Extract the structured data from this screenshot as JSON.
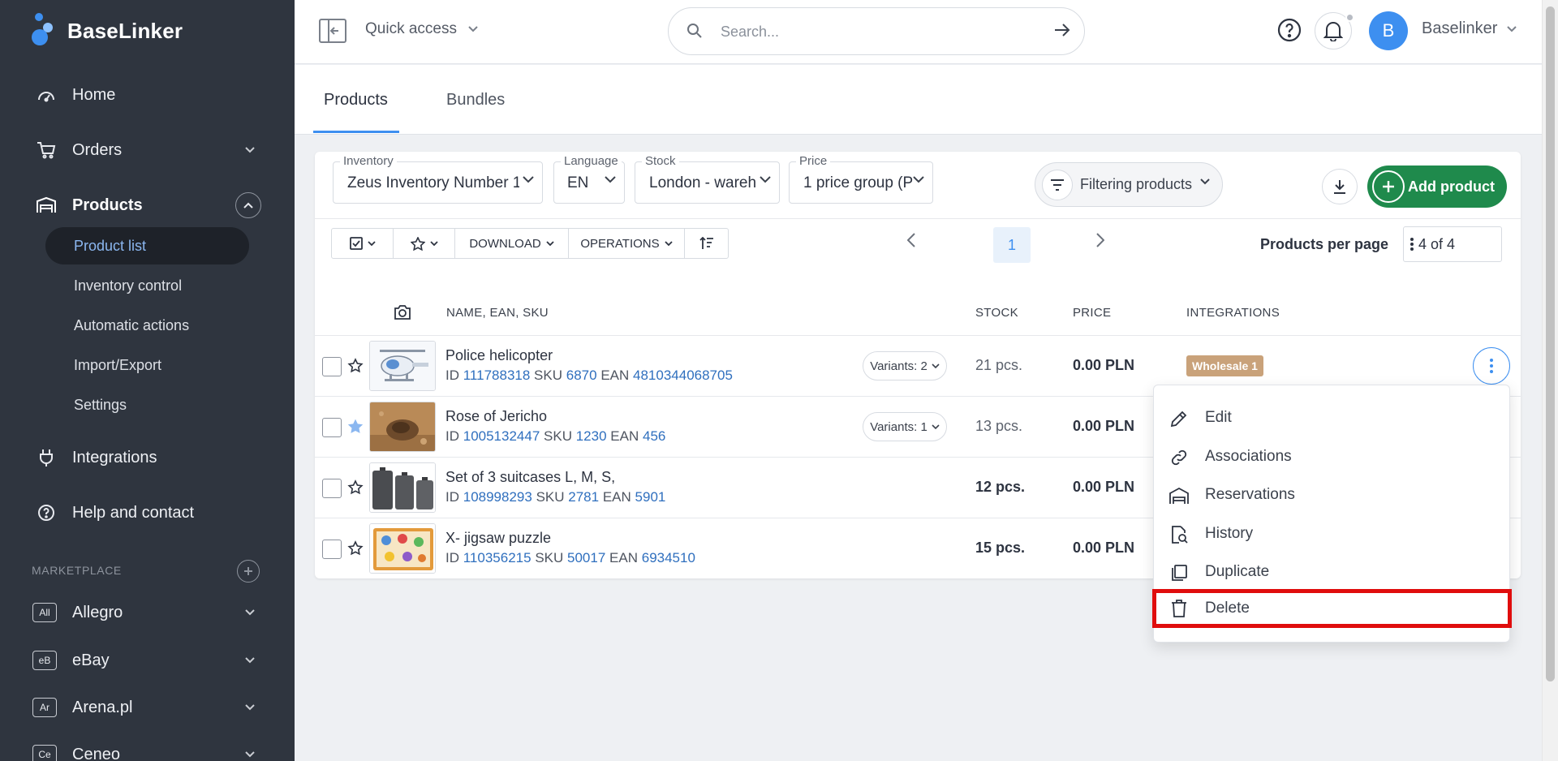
{
  "app": {
    "name": "BaseLinker"
  },
  "sidebar": {
    "nav": [
      {
        "label": "Home",
        "icon": "dashboard-icon"
      },
      {
        "label": "Orders",
        "icon": "cart-icon"
      },
      {
        "label": "Products",
        "icon": "warehouse-icon"
      },
      {
        "label": "Integrations",
        "icon": "plug-icon"
      },
      {
        "label": "Help and contact",
        "icon": "help-circle-icon"
      }
    ],
    "products_sub": [
      {
        "label": "Product list",
        "active": true
      },
      {
        "label": "Inventory control"
      },
      {
        "label": "Automatic actions"
      },
      {
        "label": "Import/Export"
      },
      {
        "label": "Settings"
      }
    ],
    "marketplace_label": "MARKETPLACE",
    "marketplaces": [
      {
        "badge": "All",
        "label": "Allegro"
      },
      {
        "badge": "eB",
        "label": "eBay"
      },
      {
        "badge": "Ar",
        "label": "Arena.pl"
      },
      {
        "badge": "Ce",
        "label": "Ceneo"
      }
    ]
  },
  "topbar": {
    "quick_access": "Quick access",
    "search_placeholder": "Search...",
    "user_initial": "B",
    "user_name": "Baselinker"
  },
  "tabs": [
    {
      "label": "Products",
      "active": true
    },
    {
      "label": "Bundles",
      "active": false
    }
  ],
  "filters": {
    "inventory": {
      "label": "Inventory",
      "value": "Zeus Inventory Number 1"
    },
    "language": {
      "label": "Language",
      "value": "EN"
    },
    "stock": {
      "label": "Stock",
      "value": "London - wareh"
    },
    "price": {
      "label": "Price",
      "value": "1 price group (P"
    },
    "filtering_label": "Filtering products",
    "add_product_label": "Add product"
  },
  "toolbar": {
    "download_label": "DOWNLOAD",
    "operations_label": "OPERATIONS",
    "current_page": "1",
    "per_page_label": "Products per page",
    "per_page_value": "4 of 4"
  },
  "table": {
    "headers": {
      "name": "NAME, EAN, SKU",
      "stock": "STOCK",
      "price": "PRICE",
      "integrations": "INTEGRATIONS"
    },
    "rows": [
      {
        "name": "Police helicopter",
        "id_label": "ID",
        "id": "111788318",
        "sku_label": "SKU",
        "sku": "6870",
        "ean_label": "EAN",
        "ean": "4810344068705",
        "variants": "Variants: 2",
        "stock": "21 pcs.",
        "price": "0.00 PLN",
        "integration": "Wholesale 1",
        "starred": false
      },
      {
        "name": "Rose of Jericho",
        "id_label": "ID",
        "id": "1005132447",
        "sku_label": "SKU",
        "sku": "1230",
        "ean_label": "EAN",
        "ean": "456",
        "variants": "Variants: 1",
        "stock": "13 pcs.",
        "price": "0.00 PLN",
        "starred": true
      },
      {
        "name": "Set of 3 suitcases L, M, S,",
        "id_label": "ID",
        "id": "108998293",
        "sku_label": "SKU",
        "sku": "2781",
        "ean_label": "EAN",
        "ean": "5901",
        "stock": "12 pcs.",
        "price": "0.00 PLN",
        "starred": false
      },
      {
        "name": "X- jigsaw puzzle",
        "id_label": "ID",
        "id": "110356215",
        "sku_label": "SKU",
        "sku": "50017",
        "ean_label": "EAN",
        "ean": "6934510",
        "stock": "15 pcs.",
        "price": "0.00 PLN",
        "starred": false
      }
    ]
  },
  "row_menu": {
    "items": [
      {
        "label": "Edit",
        "icon": "pencil-icon"
      },
      {
        "label": "Associations",
        "icon": "link-icon"
      },
      {
        "label": "Reservations",
        "icon": "reservation-icon"
      },
      {
        "label": "History",
        "icon": "history-icon"
      },
      {
        "label": "Duplicate",
        "icon": "duplicate-icon"
      },
      {
        "label": "Delete",
        "icon": "trash-icon",
        "highlighted": true
      }
    ]
  },
  "colors": {
    "sidebar_bg": "#2f353f",
    "accent_blue": "#3d8ff0",
    "add_green": "#1f8a4c",
    "highlight_red": "#e00d0d",
    "wholesale_badge": "#c9a27a"
  }
}
